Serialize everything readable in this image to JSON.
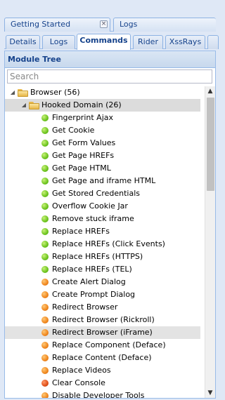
{
  "outer_tabs": [
    {
      "label": "Getting Started",
      "close": "×"
    },
    {
      "label": "Logs"
    }
  ],
  "inner_tabs": [
    {
      "label": "Details",
      "active": false
    },
    {
      "label": "Logs",
      "active": false
    },
    {
      "label": "Commands",
      "active": true
    },
    {
      "label": "Rider",
      "active": false
    },
    {
      "label": "XssRays",
      "active": false
    }
  ],
  "panel": {
    "title": "Module Tree",
    "search_placeholder": "Search"
  },
  "tree": {
    "root": {
      "label": "Browser (56)",
      "arrow": "◢"
    },
    "group": {
      "label": "Hooked Domain (26)",
      "arrow": "◢"
    },
    "items": [
      {
        "label": "Fingerprint Ajax",
        "status": "green"
      },
      {
        "label": "Get Cookie",
        "status": "green"
      },
      {
        "label": "Get Form Values",
        "status": "green"
      },
      {
        "label": "Get Page HREFs",
        "status": "green"
      },
      {
        "label": "Get Page HTML",
        "status": "green"
      },
      {
        "label": "Get Page and iframe HTML",
        "status": "green"
      },
      {
        "label": "Get Stored Credentials",
        "status": "green"
      },
      {
        "label": "Overflow Cookie Jar",
        "status": "green"
      },
      {
        "label": "Remove stuck iframe",
        "status": "green"
      },
      {
        "label": "Replace HREFs",
        "status": "green"
      },
      {
        "label": "Replace HREFs (Click Events)",
        "status": "green"
      },
      {
        "label": "Replace HREFs (HTTPS)",
        "status": "green"
      },
      {
        "label": "Replace HREFs (TEL)",
        "status": "green"
      },
      {
        "label": "Create Alert Dialog",
        "status": "orange"
      },
      {
        "label": "Create Prompt Dialog",
        "status": "orange"
      },
      {
        "label": "Redirect Browser",
        "status": "orange"
      },
      {
        "label": "Redirect Browser (Rickroll)",
        "status": "orange"
      },
      {
        "label": "Redirect Browser (iFrame)",
        "status": "orange",
        "selected": true
      },
      {
        "label": "Replace Component (Deface)",
        "status": "orange"
      },
      {
        "label": "Replace Content (Deface)",
        "status": "orange"
      },
      {
        "label": "Replace Videos",
        "status": "orange"
      },
      {
        "label": "Clear Console",
        "status": "red"
      },
      {
        "label": "Disable Developer Tools",
        "status": "orange"
      }
    ]
  },
  "scrollbar": {
    "up": "▲",
    "down": "▼"
  }
}
